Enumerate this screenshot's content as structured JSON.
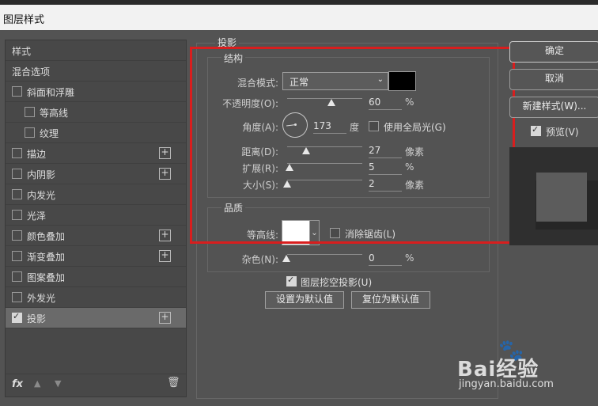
{
  "window": {
    "title": "图层样式"
  },
  "sidebar": {
    "header": "样式",
    "items": [
      {
        "label": "混合选项",
        "checkbox": false,
        "plus": false,
        "checked": false,
        "indent": 0
      },
      {
        "label": "斜面和浮雕",
        "checkbox": true,
        "plus": false,
        "checked": false,
        "indent": 0
      },
      {
        "label": "等高线",
        "checkbox": true,
        "plus": false,
        "checked": false,
        "indent": 1
      },
      {
        "label": "纹理",
        "checkbox": true,
        "plus": false,
        "checked": false,
        "indent": 1
      },
      {
        "label": "描边",
        "checkbox": true,
        "plus": true,
        "checked": false,
        "indent": 0
      },
      {
        "label": "内阴影",
        "checkbox": true,
        "plus": true,
        "checked": false,
        "indent": 0
      },
      {
        "label": "内发光",
        "checkbox": true,
        "plus": false,
        "checked": false,
        "indent": 0
      },
      {
        "label": "光泽",
        "checkbox": true,
        "plus": false,
        "checked": false,
        "indent": 0
      },
      {
        "label": "颜色叠加",
        "checkbox": true,
        "plus": true,
        "checked": false,
        "indent": 0
      },
      {
        "label": "渐变叠加",
        "checkbox": true,
        "plus": true,
        "checked": false,
        "indent": 0
      },
      {
        "label": "图案叠加",
        "checkbox": true,
        "plus": false,
        "checked": false,
        "indent": 0
      },
      {
        "label": "外发光",
        "checkbox": true,
        "plus": false,
        "checked": false,
        "indent": 0
      },
      {
        "label": "投影",
        "checkbox": true,
        "plus": true,
        "checked": true,
        "indent": 0
      }
    ],
    "footer": {
      "fx": "fx"
    }
  },
  "main": {
    "section_title": "投影",
    "structure": {
      "title": "结构",
      "blend_mode_label": "混合模式:",
      "blend_mode_value": "正常",
      "shadow_color": "#000000",
      "opacity_label": "不透明度(O):",
      "opacity_value": "60",
      "opacity_unit": "%",
      "angle_label": "角度(A):",
      "angle_value": "173",
      "angle_unit": "度",
      "global_light_label": "使用全局光(G)",
      "distance_label": "距离(D):",
      "distance_value": "27",
      "distance_unit": "像素",
      "spread_label": "扩展(R):",
      "spread_value": "5",
      "spread_unit": "%",
      "size_label": "大小(S):",
      "size_value": "2",
      "size_unit": "像素"
    },
    "quality": {
      "title": "品质",
      "contour_label": "等高线:",
      "anti_alias_label": "消除锯齿(L)",
      "noise_label": "杂色(N):",
      "noise_value": "0",
      "noise_unit": "%"
    },
    "knockout_label": "图层挖空投影(U)",
    "set_default_label": "设置为默认值",
    "reset_default_label": "复位为默认值"
  },
  "right": {
    "ok_label": "确定",
    "cancel_label": "取消",
    "new_style_label": "新建样式(W)...",
    "preview_label": "预览(V)"
  },
  "watermark": {
    "text": "Bai经验",
    "url": "jingyan.baidu.com"
  },
  "colors": {
    "highlight": "#d81e1e",
    "panel": "#535353"
  }
}
